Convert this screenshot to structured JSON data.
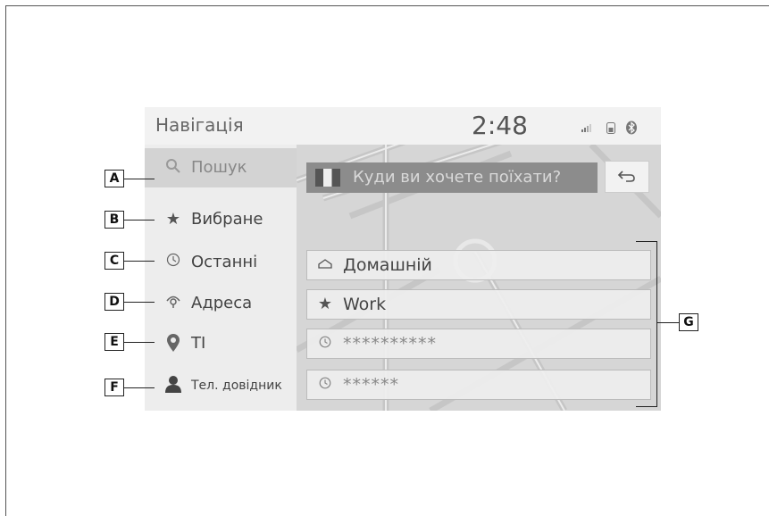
{
  "header": {
    "title": "Навігація",
    "time": "2:48"
  },
  "status_icons": [
    "signal-icon",
    "phone-battery-icon",
    "bluetooth-icon"
  ],
  "sidebar": {
    "items": [
      {
        "label": "Пошук",
        "icon": "search-icon"
      },
      {
        "label": "Вибране",
        "icon": "star-icon"
      },
      {
        "label": "Останні",
        "icon": "clock-icon"
      },
      {
        "label": "Адреса",
        "icon": "address-icon"
      },
      {
        "label": "TI",
        "icon": "poi-pin-icon"
      },
      {
        "label": "Тел. довідник",
        "icon": "person-icon"
      }
    ]
  },
  "search": {
    "placeholder": "Куди ви хочете поїхати?"
  },
  "favorites": [
    {
      "label": "Домашній",
      "icon": "home-icon"
    },
    {
      "label": "Work",
      "icon": "star-icon"
    },
    {
      "label": "**********",
      "icon": "clock-icon"
    },
    {
      "label": "******",
      "icon": "clock-icon"
    }
  ],
  "callouts": [
    "A",
    "B",
    "C",
    "D",
    "E",
    "F",
    "G"
  ]
}
